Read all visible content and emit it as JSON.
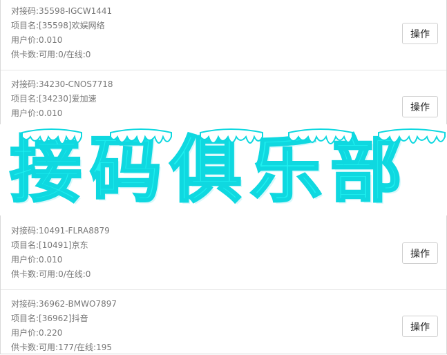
{
  "cards": [
    {
      "code": "对接码:35598-IGCW1441",
      "project": "项目名:[35598]欢娱网络",
      "price": "用户价:0.010",
      "stock": "供卡数:可用:0/在线:0",
      "button": "操作"
    },
    {
      "code": "对接码:34230-CNOS7718",
      "project": "项目名:[34230]爱加速",
      "price": "用户价:0.010",
      "stock": "",
      "button": "操作"
    },
    {
      "code": "对接码:10491-FLRA8879",
      "project": "项目名:[10491]京东",
      "price": "用户价:0.010",
      "stock": "供卡数:可用:0/在线:0",
      "button": "操作"
    },
    {
      "code": "对接码:36962-BMWO7897",
      "project": "项目名:[36962]抖音",
      "price": "用户价:0.220",
      "stock": "供卡数:可用:177/在线:195",
      "button": "操作"
    }
  ],
  "watermark": {
    "text": "接码俱乐部",
    "color": "#1ff0f0"
  }
}
